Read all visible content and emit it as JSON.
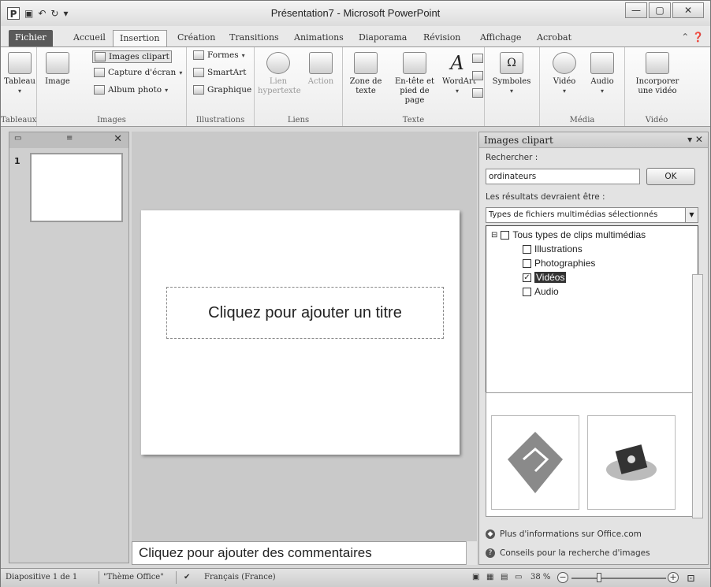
{
  "window": {
    "title": "Présentation7 - Microsoft PowerPoint",
    "app_icon": "P",
    "controls": {
      "minimize": "—",
      "maximize": "▢",
      "close": "✕"
    }
  },
  "tabs": [
    "Fichier",
    "Accueil",
    "Insertion",
    "Création",
    "Transitions",
    "Animations",
    "Diaporama",
    "Révision",
    "Affichage",
    "Acrobat"
  ],
  "active_tab": "Insertion",
  "ribbon": {
    "groups": {
      "tableaux": {
        "label": "Tableaux",
        "tableau": "Tableau"
      },
      "images": {
        "label": "Images",
        "image": "Image",
        "clipart": "Images clipart",
        "capture": "Capture d'écran",
        "album": "Album photo"
      },
      "illustrations": {
        "label": "Illustrations",
        "formes": "Formes",
        "smartart": "SmartArt",
        "graphique": "Graphique"
      },
      "liens": {
        "label": "Liens",
        "lien": "Lien hypertexte",
        "action": "Action"
      },
      "texte": {
        "label": "Texte",
        "zone": "Zone de texte",
        "entete": "En-tête et pied de page",
        "wordart": "WordArt"
      },
      "symboles": {
        "symboles": "Symboles"
      },
      "media": {
        "label": "Média",
        "video": "Vidéo",
        "audio": "Audio"
      },
      "video": {
        "label": "Vidéo",
        "incorporer": "Incorporer une vidéo"
      }
    }
  },
  "left_pane": {
    "slide_number": "1"
  },
  "slide": {
    "title_placeholder": "Cliquez pour ajouter un titre"
  },
  "notes": {
    "placeholder": "Cliquez pour ajouter des commentaires"
  },
  "clipart_pane": {
    "title": "Images clipart",
    "search_label": "Rechercher :",
    "search_value": "ordinateurs",
    "ok": "OK",
    "results_label": "Les résultats devraient être :",
    "results_select": "Types de fichiers multimédias sélectionnés",
    "tree": {
      "root": "Tous types de clips multimédias",
      "items": [
        {
          "label": "Illustrations",
          "checked": false
        },
        {
          "label": "Photographies",
          "checked": false
        },
        {
          "label": "Vidéos",
          "checked": true
        },
        {
          "label": "Audio",
          "checked": false
        }
      ]
    },
    "links": {
      "more_info": "Plus d'informations sur Office.com",
      "tips": "Conseils pour la recherche d'images"
    }
  },
  "status_bar": {
    "slide_info": "Diapositive 1 de 1",
    "theme": "\"Thème Office\"",
    "language": "Français (France)",
    "zoom": "38 %"
  }
}
